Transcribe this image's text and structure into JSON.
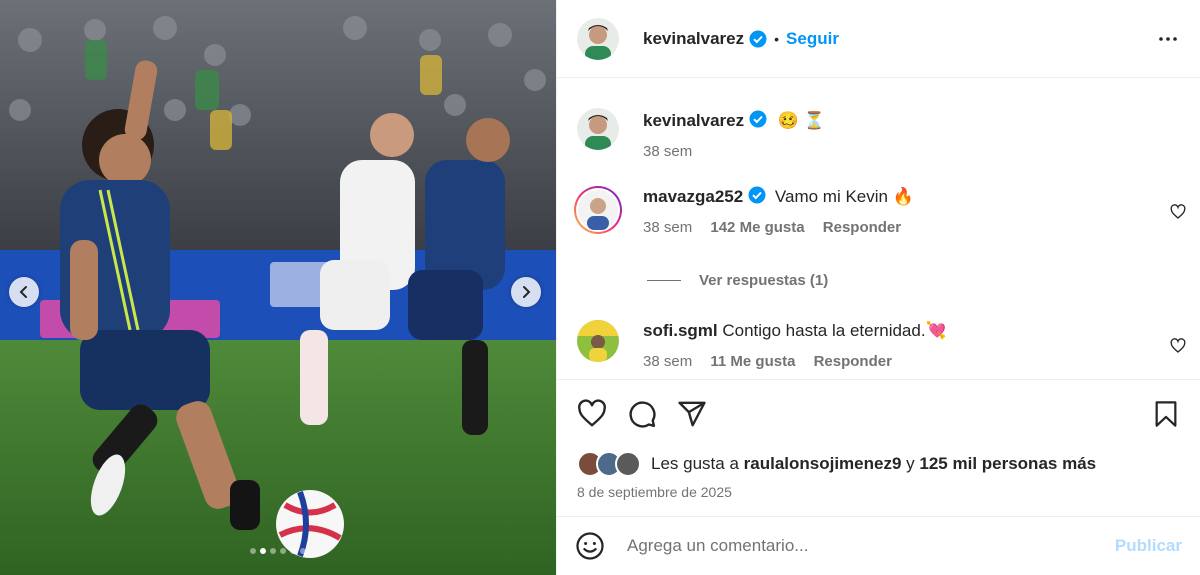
{
  "post": {
    "author": "kevinalvarez",
    "follow_label": "Seguir",
    "separator": "•",
    "caption_emojis": "🥴 ⏳",
    "caption_time": "38 sem"
  },
  "media": {
    "carousel_total": 6,
    "carousel_active": 2
  },
  "comments": [
    {
      "user": "mavazga252",
      "verified": true,
      "text": "Vamo mi Kevin 🔥",
      "time": "38 sem",
      "likes": "142 Me gusta",
      "reply_label": "Responder"
    },
    {
      "user": "sofi.sgml",
      "verified": false,
      "text": "Contigo hasta la eternidad.💘",
      "time": "38 sem",
      "likes": "11 Me gusta",
      "reply_label": "Responder"
    }
  ],
  "view_replies": "Ver respuestas (1)",
  "likes_summary": {
    "prefix": "Les gusta a",
    "user": "raulalonsojimenez9",
    "middle": "y",
    "count": "125 mil personas más"
  },
  "date": "8 de septiembre de 2025",
  "add_comment": {
    "placeholder": "Agrega un comentario...",
    "publish_label": "Publicar"
  },
  "colors": {
    "accent": "#0095f6",
    "verified": "#0095f6",
    "publish_disabled": "#b3dbff",
    "muted": "#737373"
  },
  "icons": [
    "chevron-left-icon",
    "chevron-right-icon",
    "more-icon",
    "verified-icon",
    "heart-icon",
    "comment-icon",
    "share-icon",
    "bookmark-icon",
    "emoji-icon"
  ]
}
